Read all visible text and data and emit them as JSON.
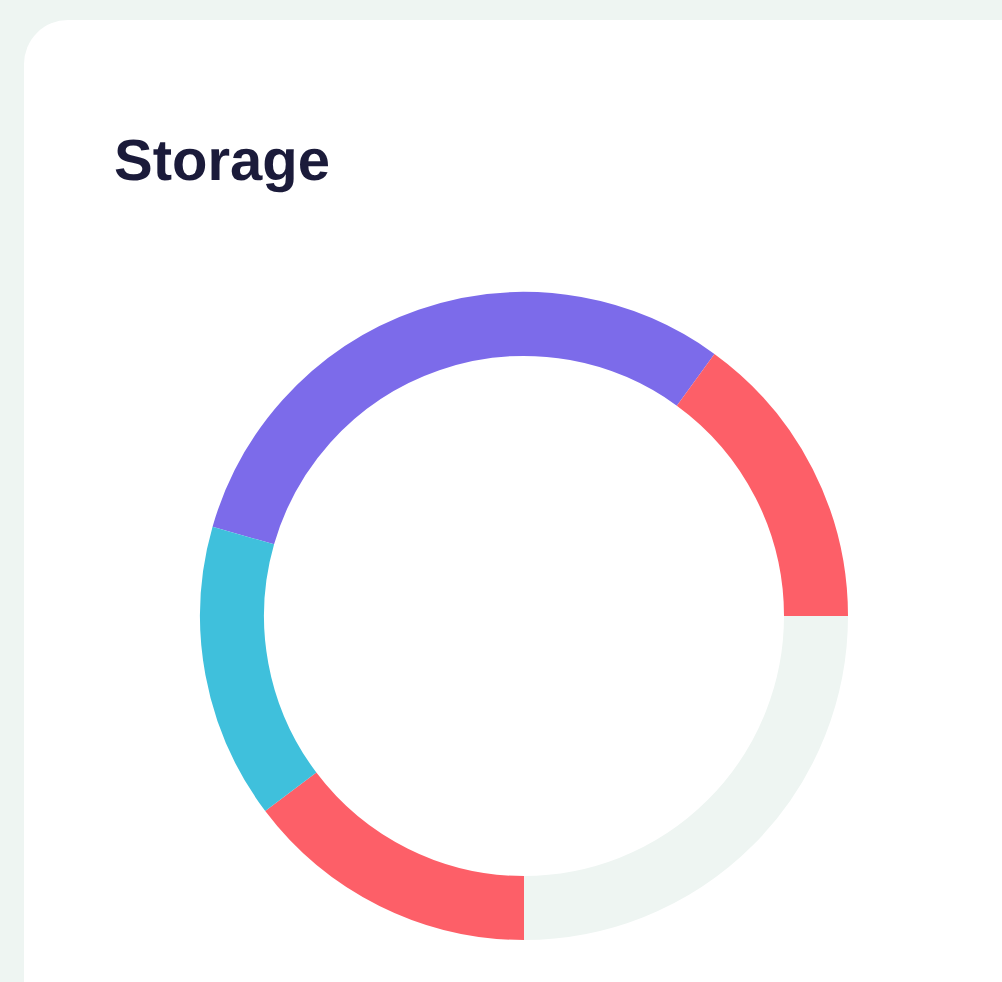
{
  "card": {
    "title": "Storage"
  }
}
